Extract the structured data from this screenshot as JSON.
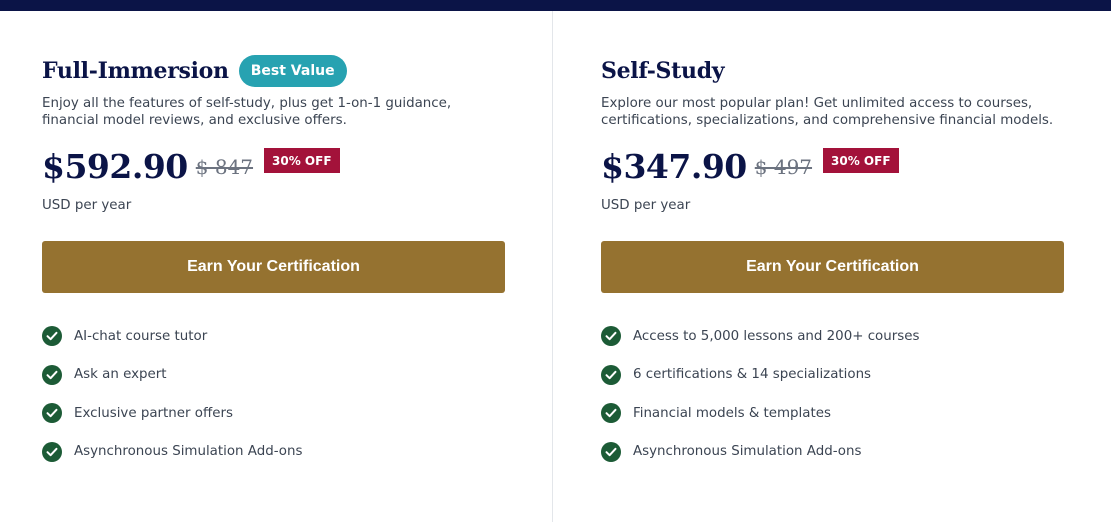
{
  "plans": [
    {
      "title": "Full-Immersion",
      "badge": "Best Value",
      "description": "Enjoy all the features of self-study, plus get 1-on-1 guidance, financial model reviews, and exclusive offers.",
      "price": "$592.90",
      "original_price": "$ 847",
      "discount": "30% OFF",
      "period": "USD per year",
      "cta_label": "Earn Your Certification",
      "features": [
        "AI-chat course tutor",
        "Ask an expert",
        "Exclusive partner offers",
        "Asynchronous Simulation Add-ons"
      ]
    },
    {
      "title": "Self-Study",
      "description": "Explore our most popular plan! Get unlimited access to courses, certifications, specializations, and comprehensive financial models.",
      "price": "$347.90",
      "original_price": "$ 497",
      "discount": "30% OFF",
      "period": "USD per year",
      "cta_label": "Earn Your Certification",
      "features": [
        "Access to 5,000 lessons and 200+ courses",
        "6 certifications & 14 specializations",
        "Financial models & templates",
        "Asynchronous Simulation Add-ons"
      ]
    }
  ],
  "icons": {
    "feature_icon": "check-circle-icon"
  },
  "colors": {
    "top_bar": "#0b1447",
    "heading": "#0b1447",
    "badge": "#27a2b1",
    "discount": "#a3123a",
    "cta": "#957230",
    "check": "#1c5b36"
  }
}
